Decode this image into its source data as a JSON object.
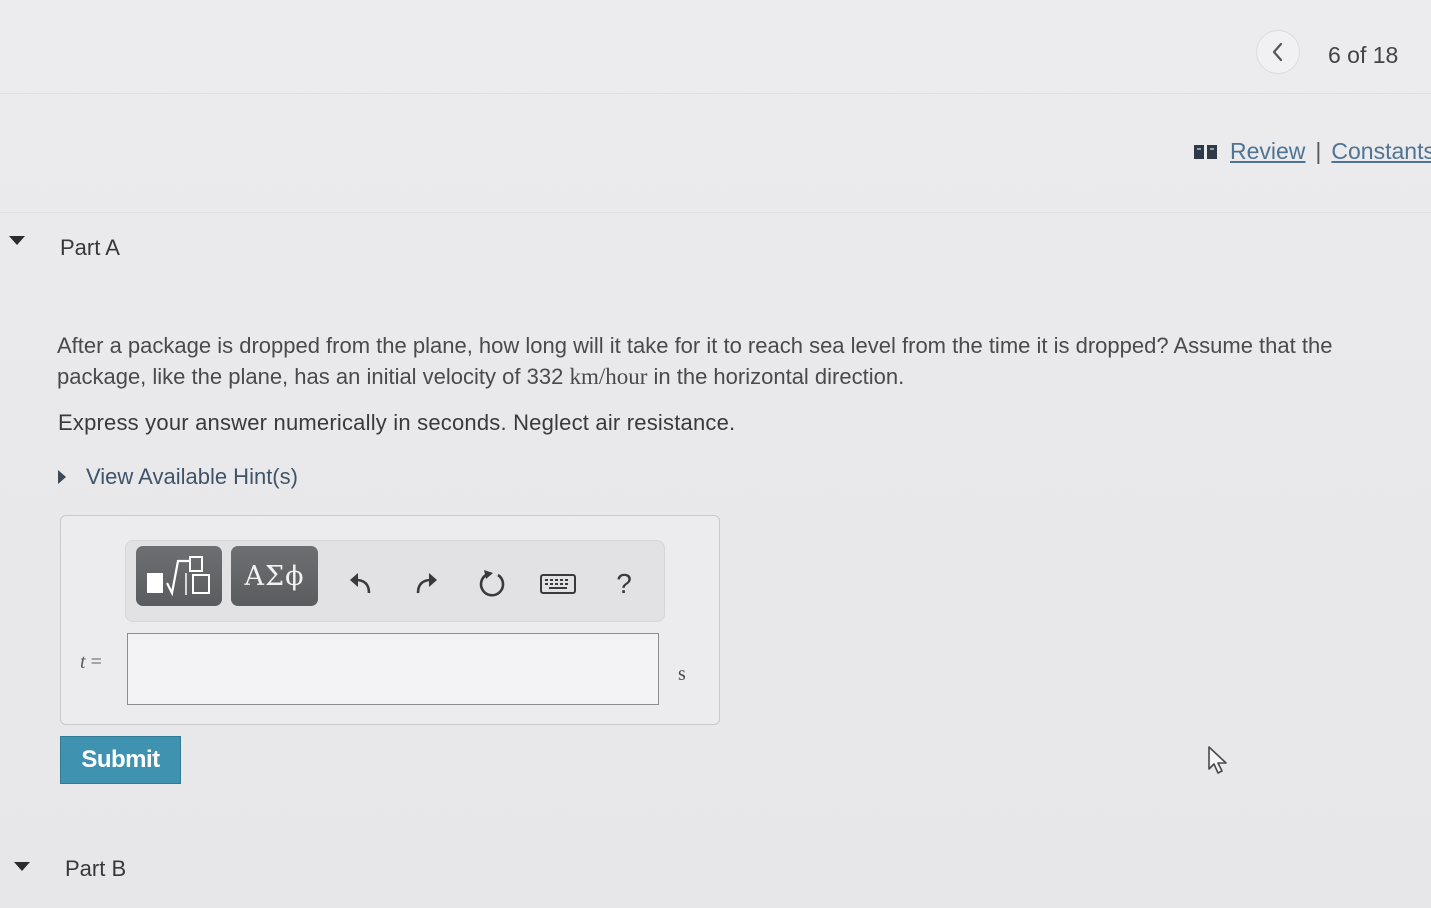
{
  "navigation": {
    "page_indicator": "6 of 18",
    "prev_icon": "chevron-left-icon"
  },
  "links": {
    "review": "Review",
    "separator": "|",
    "constants": "Constants"
  },
  "part_a": {
    "title": "Part A",
    "question_pre": "After a package is dropped from the plane, how long will it take for it to reach sea level from the time it is dropped? Assume that the package, like the plane, has an initial velocity of 332 ",
    "question_unit": "km/hour",
    "question_post": " in the horizontal direction.",
    "instruction": "Express your answer numerically in seconds. Neglect air resistance.",
    "hints_label": "View Available Hint(s)"
  },
  "toolbar": {
    "greek_label": "ΑΣϕ",
    "help_label": "?",
    "icons": [
      "templates-icon",
      "greek-letters-icon",
      "undo-icon",
      "redo-icon",
      "reset-icon",
      "keyboard-icon",
      "help-icon"
    ]
  },
  "answer": {
    "variable": "t",
    "equals": "=",
    "value": "",
    "unit": "s"
  },
  "submit_label": "Submit",
  "part_b": {
    "title": "Part B"
  },
  "colors": {
    "submit": "#3f93b0",
    "link": "#4f7392",
    "toolbar_dark": "#616366",
    "background": "#eaeaec"
  }
}
